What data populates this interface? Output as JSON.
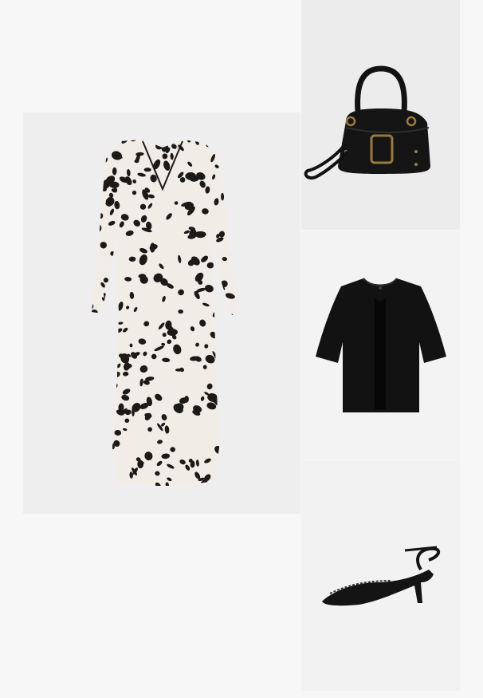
{
  "products": [
    {
      "name": "dress",
      "description": ""
    },
    {
      "name": "handbag",
      "description": ""
    },
    {
      "name": "cardigan",
      "description": ""
    },
    {
      "name": "shoe",
      "description": ""
    }
  ],
  "colors": {
    "background": "#f7f7f7",
    "tile": "#eeeeee",
    "print_light": "#f1ede6",
    "print_dark": "#1c1a18",
    "black_item": "#121212",
    "hardware": "#9a7a3a"
  }
}
